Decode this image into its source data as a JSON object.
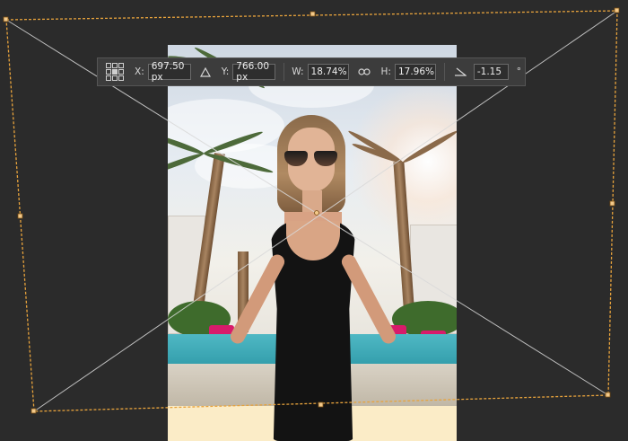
{
  "options_bar": {
    "x_label": "X:",
    "x_value": "697.50 px",
    "y_label": "Y:",
    "y_value": "766.00 px",
    "w_label": "W:",
    "w_value": "18.74%",
    "h_label": "H:",
    "h_value": "17.96%",
    "angle_value": "-1.15",
    "degree_symbol": "°",
    "icons": [
      "reference-point-icon",
      "delta-triangle-icon",
      "link-icon",
      "angle-icon"
    ]
  },
  "colors": {
    "canvas_bg": "#2b2b2b",
    "bounding_box": "#e8a33c",
    "guide_line": "#d9d9d9"
  }
}
